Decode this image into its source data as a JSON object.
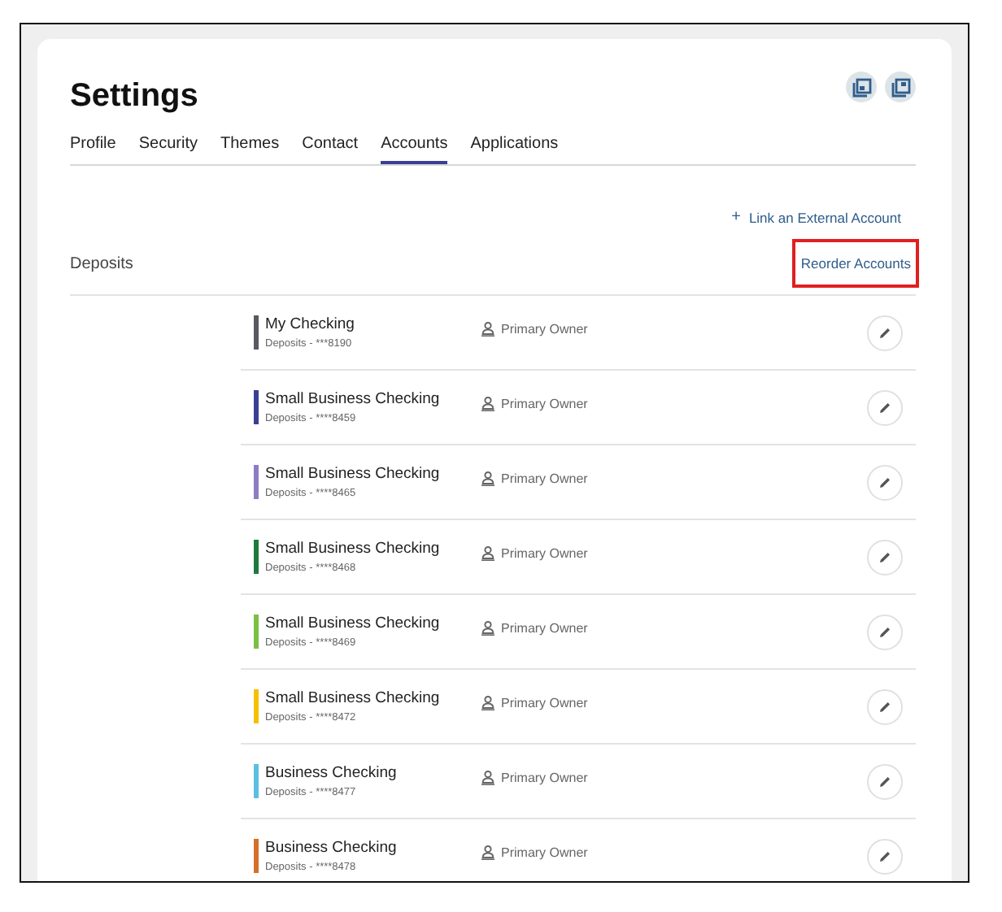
{
  "page": {
    "title": "Settings"
  },
  "tabs": [
    {
      "label": "Profile",
      "selected": false
    },
    {
      "label": "Security",
      "selected": false
    },
    {
      "label": "Themes",
      "selected": false
    },
    {
      "label": "Contact",
      "selected": false
    },
    {
      "label": "Accounts",
      "selected": true
    },
    {
      "label": "Applications",
      "selected": false
    }
  ],
  "link_external": {
    "icon": "+",
    "label": "Link an External Account"
  },
  "section": {
    "title": "Deposits",
    "reorder_link": {
      "label": "Reorder Accounts",
      "highlighted": true
    }
  },
  "accounts": [
    {
      "name": "My Checking",
      "detail": "Deposits - ***8190",
      "owner": "Primary Owner",
      "color": "#5a5860"
    },
    {
      "name": "Small Business Checking",
      "detail": "Deposits - ****8459",
      "owner": "Primary Owner",
      "color": "#3a3f94"
    },
    {
      "name": "Small Business Checking",
      "detail": "Deposits - ****8465",
      "owner": "Primary Owner",
      "color": "#8e7cc3"
    },
    {
      "name": "Small Business Checking",
      "detail": "Deposits - ****8468",
      "owner": "Primary Owner",
      "color": "#1e7a3c"
    },
    {
      "name": "Small Business Checking",
      "detail": "Deposits - ****8469",
      "owner": "Primary Owner",
      "color": "#7bc043"
    },
    {
      "name": "Small Business Checking",
      "detail": "Deposits - ****8472",
      "owner": "Primary Owner",
      "color": "#f5c000"
    },
    {
      "name": "Business Checking",
      "detail": "Deposits - ****8477",
      "owner": "Primary Owner",
      "color": "#5bc0e0"
    },
    {
      "name": "Business Checking",
      "detail": "Deposits - ****8478",
      "owner": "Primary Owner",
      "color": "#d4702a"
    }
  ]
}
